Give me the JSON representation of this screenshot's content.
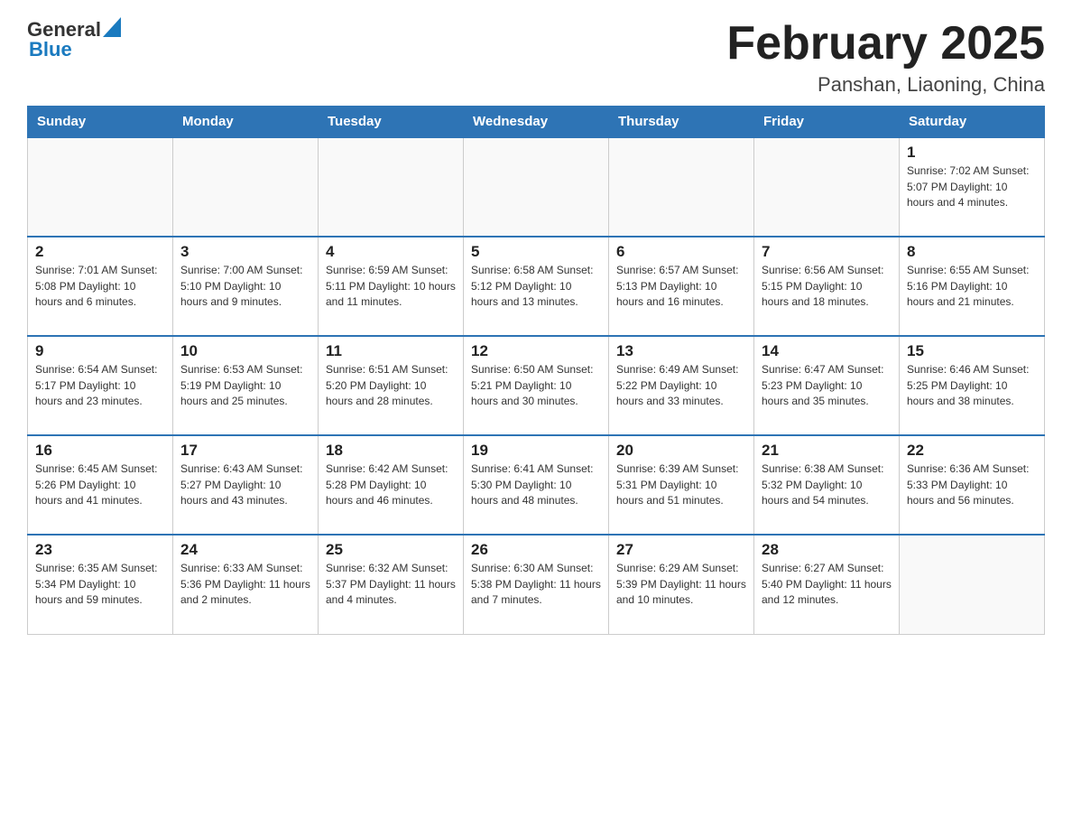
{
  "header": {
    "logo_general": "General",
    "logo_blue": "Blue",
    "month_title": "February 2025",
    "subtitle": "Panshan, Liaoning, China"
  },
  "weekdays": [
    "Sunday",
    "Monday",
    "Tuesday",
    "Wednesday",
    "Thursday",
    "Friday",
    "Saturday"
  ],
  "weeks": [
    {
      "days": [
        {
          "num": "",
          "info": ""
        },
        {
          "num": "",
          "info": ""
        },
        {
          "num": "",
          "info": ""
        },
        {
          "num": "",
          "info": ""
        },
        {
          "num": "",
          "info": ""
        },
        {
          "num": "",
          "info": ""
        },
        {
          "num": "1",
          "info": "Sunrise: 7:02 AM\nSunset: 5:07 PM\nDaylight: 10 hours\nand 4 minutes."
        }
      ]
    },
    {
      "days": [
        {
          "num": "2",
          "info": "Sunrise: 7:01 AM\nSunset: 5:08 PM\nDaylight: 10 hours\nand 6 minutes."
        },
        {
          "num": "3",
          "info": "Sunrise: 7:00 AM\nSunset: 5:10 PM\nDaylight: 10 hours\nand 9 minutes."
        },
        {
          "num": "4",
          "info": "Sunrise: 6:59 AM\nSunset: 5:11 PM\nDaylight: 10 hours\nand 11 minutes."
        },
        {
          "num": "5",
          "info": "Sunrise: 6:58 AM\nSunset: 5:12 PM\nDaylight: 10 hours\nand 13 minutes."
        },
        {
          "num": "6",
          "info": "Sunrise: 6:57 AM\nSunset: 5:13 PM\nDaylight: 10 hours\nand 16 minutes."
        },
        {
          "num": "7",
          "info": "Sunrise: 6:56 AM\nSunset: 5:15 PM\nDaylight: 10 hours\nand 18 minutes."
        },
        {
          "num": "8",
          "info": "Sunrise: 6:55 AM\nSunset: 5:16 PM\nDaylight: 10 hours\nand 21 minutes."
        }
      ]
    },
    {
      "days": [
        {
          "num": "9",
          "info": "Sunrise: 6:54 AM\nSunset: 5:17 PM\nDaylight: 10 hours\nand 23 minutes."
        },
        {
          "num": "10",
          "info": "Sunrise: 6:53 AM\nSunset: 5:19 PM\nDaylight: 10 hours\nand 25 minutes."
        },
        {
          "num": "11",
          "info": "Sunrise: 6:51 AM\nSunset: 5:20 PM\nDaylight: 10 hours\nand 28 minutes."
        },
        {
          "num": "12",
          "info": "Sunrise: 6:50 AM\nSunset: 5:21 PM\nDaylight: 10 hours\nand 30 minutes."
        },
        {
          "num": "13",
          "info": "Sunrise: 6:49 AM\nSunset: 5:22 PM\nDaylight: 10 hours\nand 33 minutes."
        },
        {
          "num": "14",
          "info": "Sunrise: 6:47 AM\nSunset: 5:23 PM\nDaylight: 10 hours\nand 35 minutes."
        },
        {
          "num": "15",
          "info": "Sunrise: 6:46 AM\nSunset: 5:25 PM\nDaylight: 10 hours\nand 38 minutes."
        }
      ]
    },
    {
      "days": [
        {
          "num": "16",
          "info": "Sunrise: 6:45 AM\nSunset: 5:26 PM\nDaylight: 10 hours\nand 41 minutes."
        },
        {
          "num": "17",
          "info": "Sunrise: 6:43 AM\nSunset: 5:27 PM\nDaylight: 10 hours\nand 43 minutes."
        },
        {
          "num": "18",
          "info": "Sunrise: 6:42 AM\nSunset: 5:28 PM\nDaylight: 10 hours\nand 46 minutes."
        },
        {
          "num": "19",
          "info": "Sunrise: 6:41 AM\nSunset: 5:30 PM\nDaylight: 10 hours\nand 48 minutes."
        },
        {
          "num": "20",
          "info": "Sunrise: 6:39 AM\nSunset: 5:31 PM\nDaylight: 10 hours\nand 51 minutes."
        },
        {
          "num": "21",
          "info": "Sunrise: 6:38 AM\nSunset: 5:32 PM\nDaylight: 10 hours\nand 54 minutes."
        },
        {
          "num": "22",
          "info": "Sunrise: 6:36 AM\nSunset: 5:33 PM\nDaylight: 10 hours\nand 56 minutes."
        }
      ]
    },
    {
      "days": [
        {
          "num": "23",
          "info": "Sunrise: 6:35 AM\nSunset: 5:34 PM\nDaylight: 10 hours\nand 59 minutes."
        },
        {
          "num": "24",
          "info": "Sunrise: 6:33 AM\nSunset: 5:36 PM\nDaylight: 11 hours\nand 2 minutes."
        },
        {
          "num": "25",
          "info": "Sunrise: 6:32 AM\nSunset: 5:37 PM\nDaylight: 11 hours\nand 4 minutes."
        },
        {
          "num": "26",
          "info": "Sunrise: 6:30 AM\nSunset: 5:38 PM\nDaylight: 11 hours\nand 7 minutes."
        },
        {
          "num": "27",
          "info": "Sunrise: 6:29 AM\nSunset: 5:39 PM\nDaylight: 11 hours\nand 10 minutes."
        },
        {
          "num": "28",
          "info": "Sunrise: 6:27 AM\nSunset: 5:40 PM\nDaylight: 11 hours\nand 12 minutes."
        },
        {
          "num": "",
          "info": ""
        }
      ]
    }
  ]
}
